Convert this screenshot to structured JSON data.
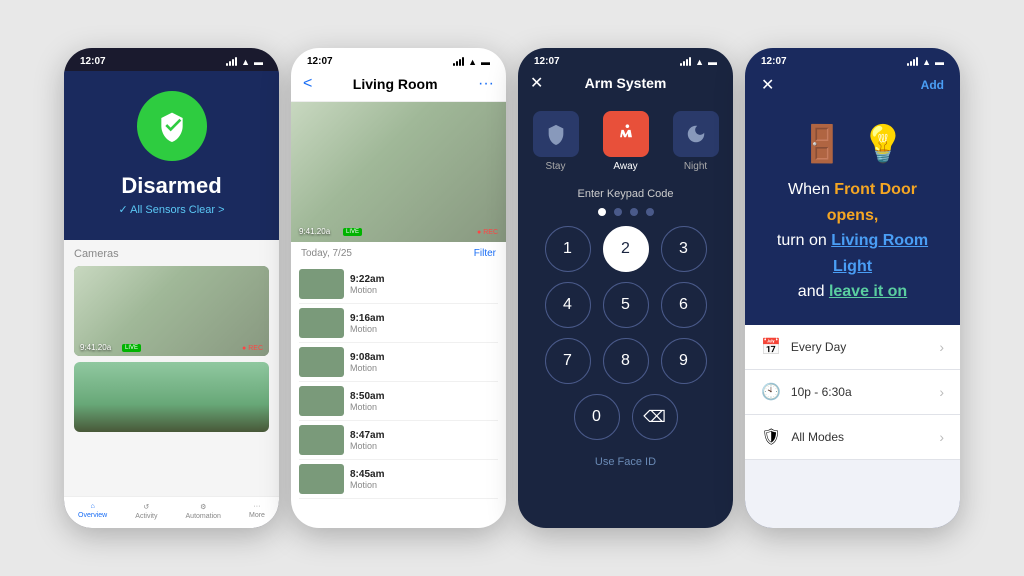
{
  "phone1": {
    "status_time": "12:07",
    "status": "Disarmed",
    "sensors_clear": "✓ All Sensors Clear >",
    "cameras_label": "Cameras",
    "cam1_time": "9:41.20a",
    "cam1_live": "LIVE",
    "cam1_rec": "● REC",
    "nav_items": [
      {
        "label": "Overview",
        "icon": "⌂",
        "active": true
      },
      {
        "label": "Activity",
        "icon": "↺",
        "active": false
      },
      {
        "label": "Automation",
        "icon": "⚙",
        "active": false
      },
      {
        "label": "More",
        "icon": "···",
        "active": false
      }
    ]
  },
  "phone2": {
    "status_time": "12:07",
    "header_title": "Living Room",
    "back_icon": "<",
    "more_icon": "···",
    "cam_time": "9:41.20a",
    "cam_live": "LIVE",
    "cam_rec": "● REC",
    "activity_date": "Today, 7/25",
    "filter_label": "Filter",
    "activities": [
      {
        "time": "9:22am",
        "type": "Motion"
      },
      {
        "time": "9:16am",
        "type": "Motion"
      },
      {
        "time": "9:08am",
        "type": "Motion"
      },
      {
        "time": "8:50am",
        "type": "Motion"
      },
      {
        "time": "8:47am",
        "type": "Motion"
      },
      {
        "time": "8:45am",
        "type": "Motion"
      }
    ]
  },
  "phone3": {
    "status_time": "12:07",
    "header_title": "Arm System",
    "close_icon": "✕",
    "modes": [
      {
        "label": "Stay",
        "icon": "🛡",
        "active": false
      },
      {
        "label": "Away",
        "icon": "🚶",
        "active": true
      },
      {
        "label": "Night",
        "icon": "🌙",
        "active": false
      }
    ],
    "keypad_label": "Enter Keypad Code",
    "keys": [
      [
        "1",
        "2",
        "3"
      ],
      [
        "4",
        "5",
        "6"
      ],
      [
        "7",
        "8",
        "9"
      ],
      [
        "0",
        "⌫"
      ]
    ],
    "active_key": "2",
    "face_id_label": "Use Face ID"
  },
  "phone4": {
    "status_time": "12:07",
    "close_icon": "✕",
    "add_label": "Add",
    "automation_icons": [
      "🚪",
      "💡"
    ],
    "text_line1": "When ",
    "text_trigger": "Front Door opens,",
    "text_line2": "turn on ",
    "text_action": "Living Room Light",
    "text_line3": "and ",
    "text_leave": "leave it on",
    "settings": [
      {
        "icon": "📅",
        "label": "Every Day"
      },
      {
        "icon": "🕙",
        "label": "10p - 6:30a"
      },
      {
        "icon": "🛡",
        "label": "All Modes"
      }
    ]
  }
}
